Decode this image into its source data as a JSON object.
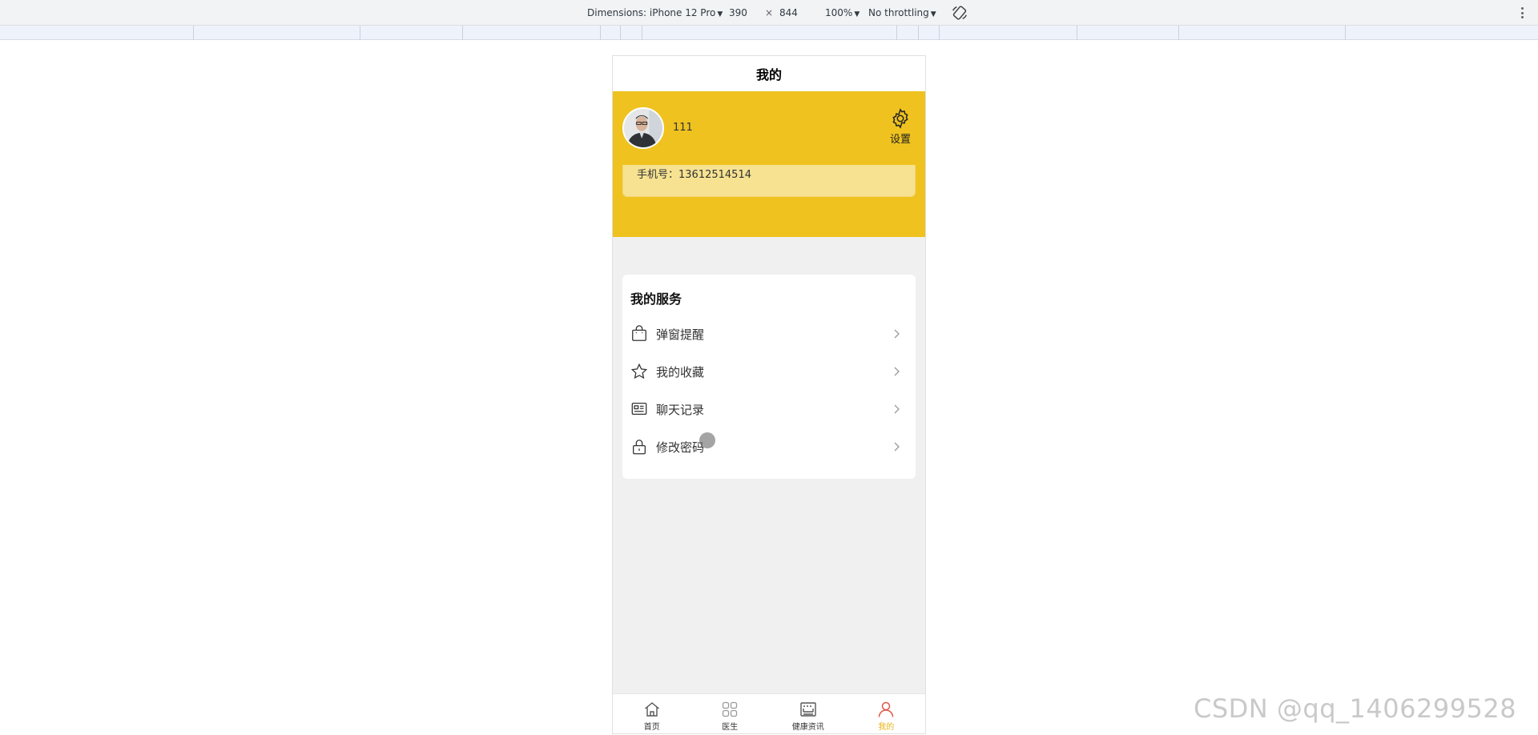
{
  "devtools": {
    "dimensions_label": "Dimensions: iPhone 12 Pro",
    "width": "390",
    "times": "×",
    "height": "844",
    "zoom": "100%",
    "throttling": "No throttling"
  },
  "app": {
    "navbar_title": "我的",
    "user": {
      "name": "111",
      "phone_label": "手机号：13612514514"
    },
    "settings_label": "设置",
    "services": {
      "title": "我的服务",
      "items": [
        {
          "label": "弹窗提醒",
          "icon": "shopping-bag-icon"
        },
        {
          "label": "我的收藏",
          "icon": "star-icon"
        },
        {
          "label": "聊天记录",
          "icon": "message-card-icon"
        },
        {
          "label": "修改密码",
          "icon": "lock-icon"
        }
      ]
    },
    "tabs": [
      {
        "label": "首页",
        "icon": "home-icon",
        "active": false
      },
      {
        "label": "医生",
        "icon": "grid-icon",
        "active": false
      },
      {
        "label": "健康资讯",
        "icon": "news-icon",
        "active": false
      },
      {
        "label": "我的",
        "icon": "user-icon",
        "active": true
      }
    ]
  },
  "colors": {
    "accent": "#efc21f",
    "tab_active": "#e7b416",
    "card": "#f6e291"
  },
  "watermark": "CSDN @qq_1406299528"
}
